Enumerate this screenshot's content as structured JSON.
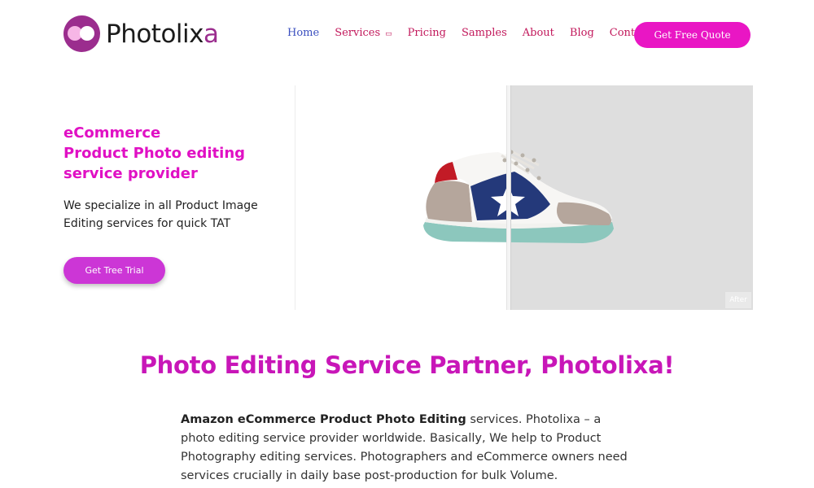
{
  "brand": {
    "name_main": "Photolix",
    "name_accent": "a",
    "colors": {
      "primary": "#e916c4",
      "logo": "#9b2d8e",
      "nav": "#c2185b",
      "nav_active": "#3b4fbf"
    }
  },
  "nav": {
    "items": [
      {
        "label": "Home",
        "active": true
      },
      {
        "label": "Services",
        "has_dropdown": true
      },
      {
        "label": "Pricing"
      },
      {
        "label": "Samples"
      },
      {
        "label": "About"
      },
      {
        "label": "Blog"
      },
      {
        "label": "Contact"
      }
    ],
    "cta_label": "Get Free Quote"
  },
  "hero": {
    "title_lines": [
      "eCommerce",
      "Product Photo editing",
      "service provider"
    ],
    "subtitle_lines": [
      "We specialize in all Product Image",
      "Editing services for quick TAT"
    ],
    "button_label": "Get Tree Trial",
    "compare_after_label": "After",
    "compare_handle_position": 0.46
  },
  "section": {
    "title": "Photo Editing Service Partner, Photolixa!",
    "lead": "Amazon eCommerce Product  Photo Editing",
    "body": " services. Photolixa – a photo editing service provider worldwide. Basically, We help to Product Photography editing services.  Photographers and eCommerce owners need services crucially in daily base post-production for bulk Volume."
  }
}
